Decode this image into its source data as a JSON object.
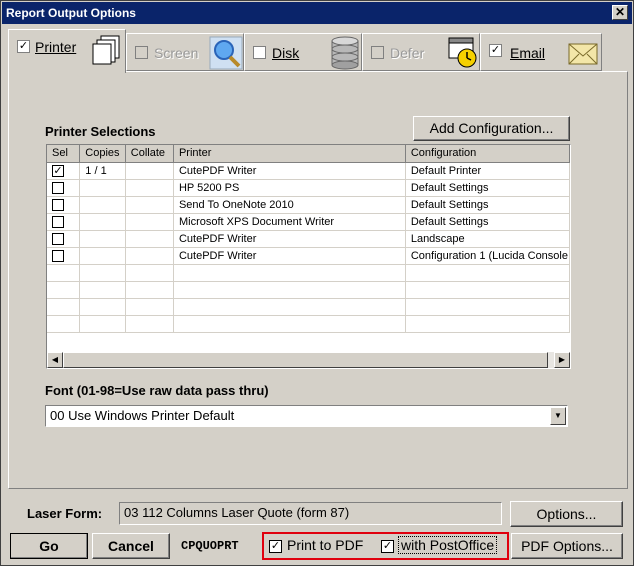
{
  "window": {
    "title": "Report Output Options",
    "close_glyph": "✕"
  },
  "tabs": [
    {
      "label": "Printer",
      "checked": true,
      "enabled": true,
      "icon": "printer-pages-icon"
    },
    {
      "label": "Screen",
      "checked": false,
      "enabled": false,
      "icon": "magnifier-icon"
    },
    {
      "label": "Disk",
      "checked": false,
      "enabled": true,
      "icon": "database-disk-icon"
    },
    {
      "label": "Defer",
      "checked": false,
      "enabled": false,
      "icon": "clock-calendar-icon"
    },
    {
      "label": "Email",
      "checked": true,
      "enabled": true,
      "icon": "envelope-icon"
    }
  ],
  "printer_selections": {
    "heading": "Printer Selections",
    "add_config_label": "Add Configuration...",
    "columns": [
      "Sel",
      "Copies",
      "Collate",
      "Printer",
      "Configuration"
    ],
    "rows": [
      {
        "sel": true,
        "copies": "1 / 1",
        "collate": "",
        "printer": "CutePDF Writer",
        "configuration": "Default Printer"
      },
      {
        "sel": false,
        "copies": "",
        "collate": "",
        "printer": "HP 5200 PS",
        "configuration": "Default Settings"
      },
      {
        "sel": false,
        "copies": "",
        "collate": "",
        "printer": "Send To OneNote 2010",
        "configuration": "Default Settings"
      },
      {
        "sel": false,
        "copies": "",
        "collate": "",
        "printer": "Microsoft XPS Document Writer",
        "configuration": "Default Settings"
      },
      {
        "sel": false,
        "copies": "",
        "collate": "",
        "printer": "CutePDF Writer",
        "configuration": "Landscape"
      },
      {
        "sel": false,
        "copies": "",
        "collate": "",
        "printer": "CutePDF Writer",
        "configuration": "Configuration 1 (Lucida Console"
      }
    ],
    "scroll_left": "◀",
    "scroll_right": "▶"
  },
  "font": {
    "label": "Font  (01-98=Use raw data pass thru)",
    "selected": "00 Use Windows Printer Default",
    "dropdown_arrow": "▼"
  },
  "laser_form": {
    "label": "Laser Form:",
    "value": "03 112 Columns Laser Quote (form 87)",
    "options_label": "Options..."
  },
  "footer": {
    "go_label": "Go",
    "cancel_label": "Cancel",
    "report_code": "CPQUOPRT",
    "print_to_pdf_label": "Print to PDF",
    "print_to_pdf_checked": true,
    "with_postoffice_label": "with PostOffice",
    "with_postoffice_checked": true,
    "pdf_options_label": "PDF Options...",
    "highlight_color": "#e0000e"
  },
  "check_glyph": "✓"
}
